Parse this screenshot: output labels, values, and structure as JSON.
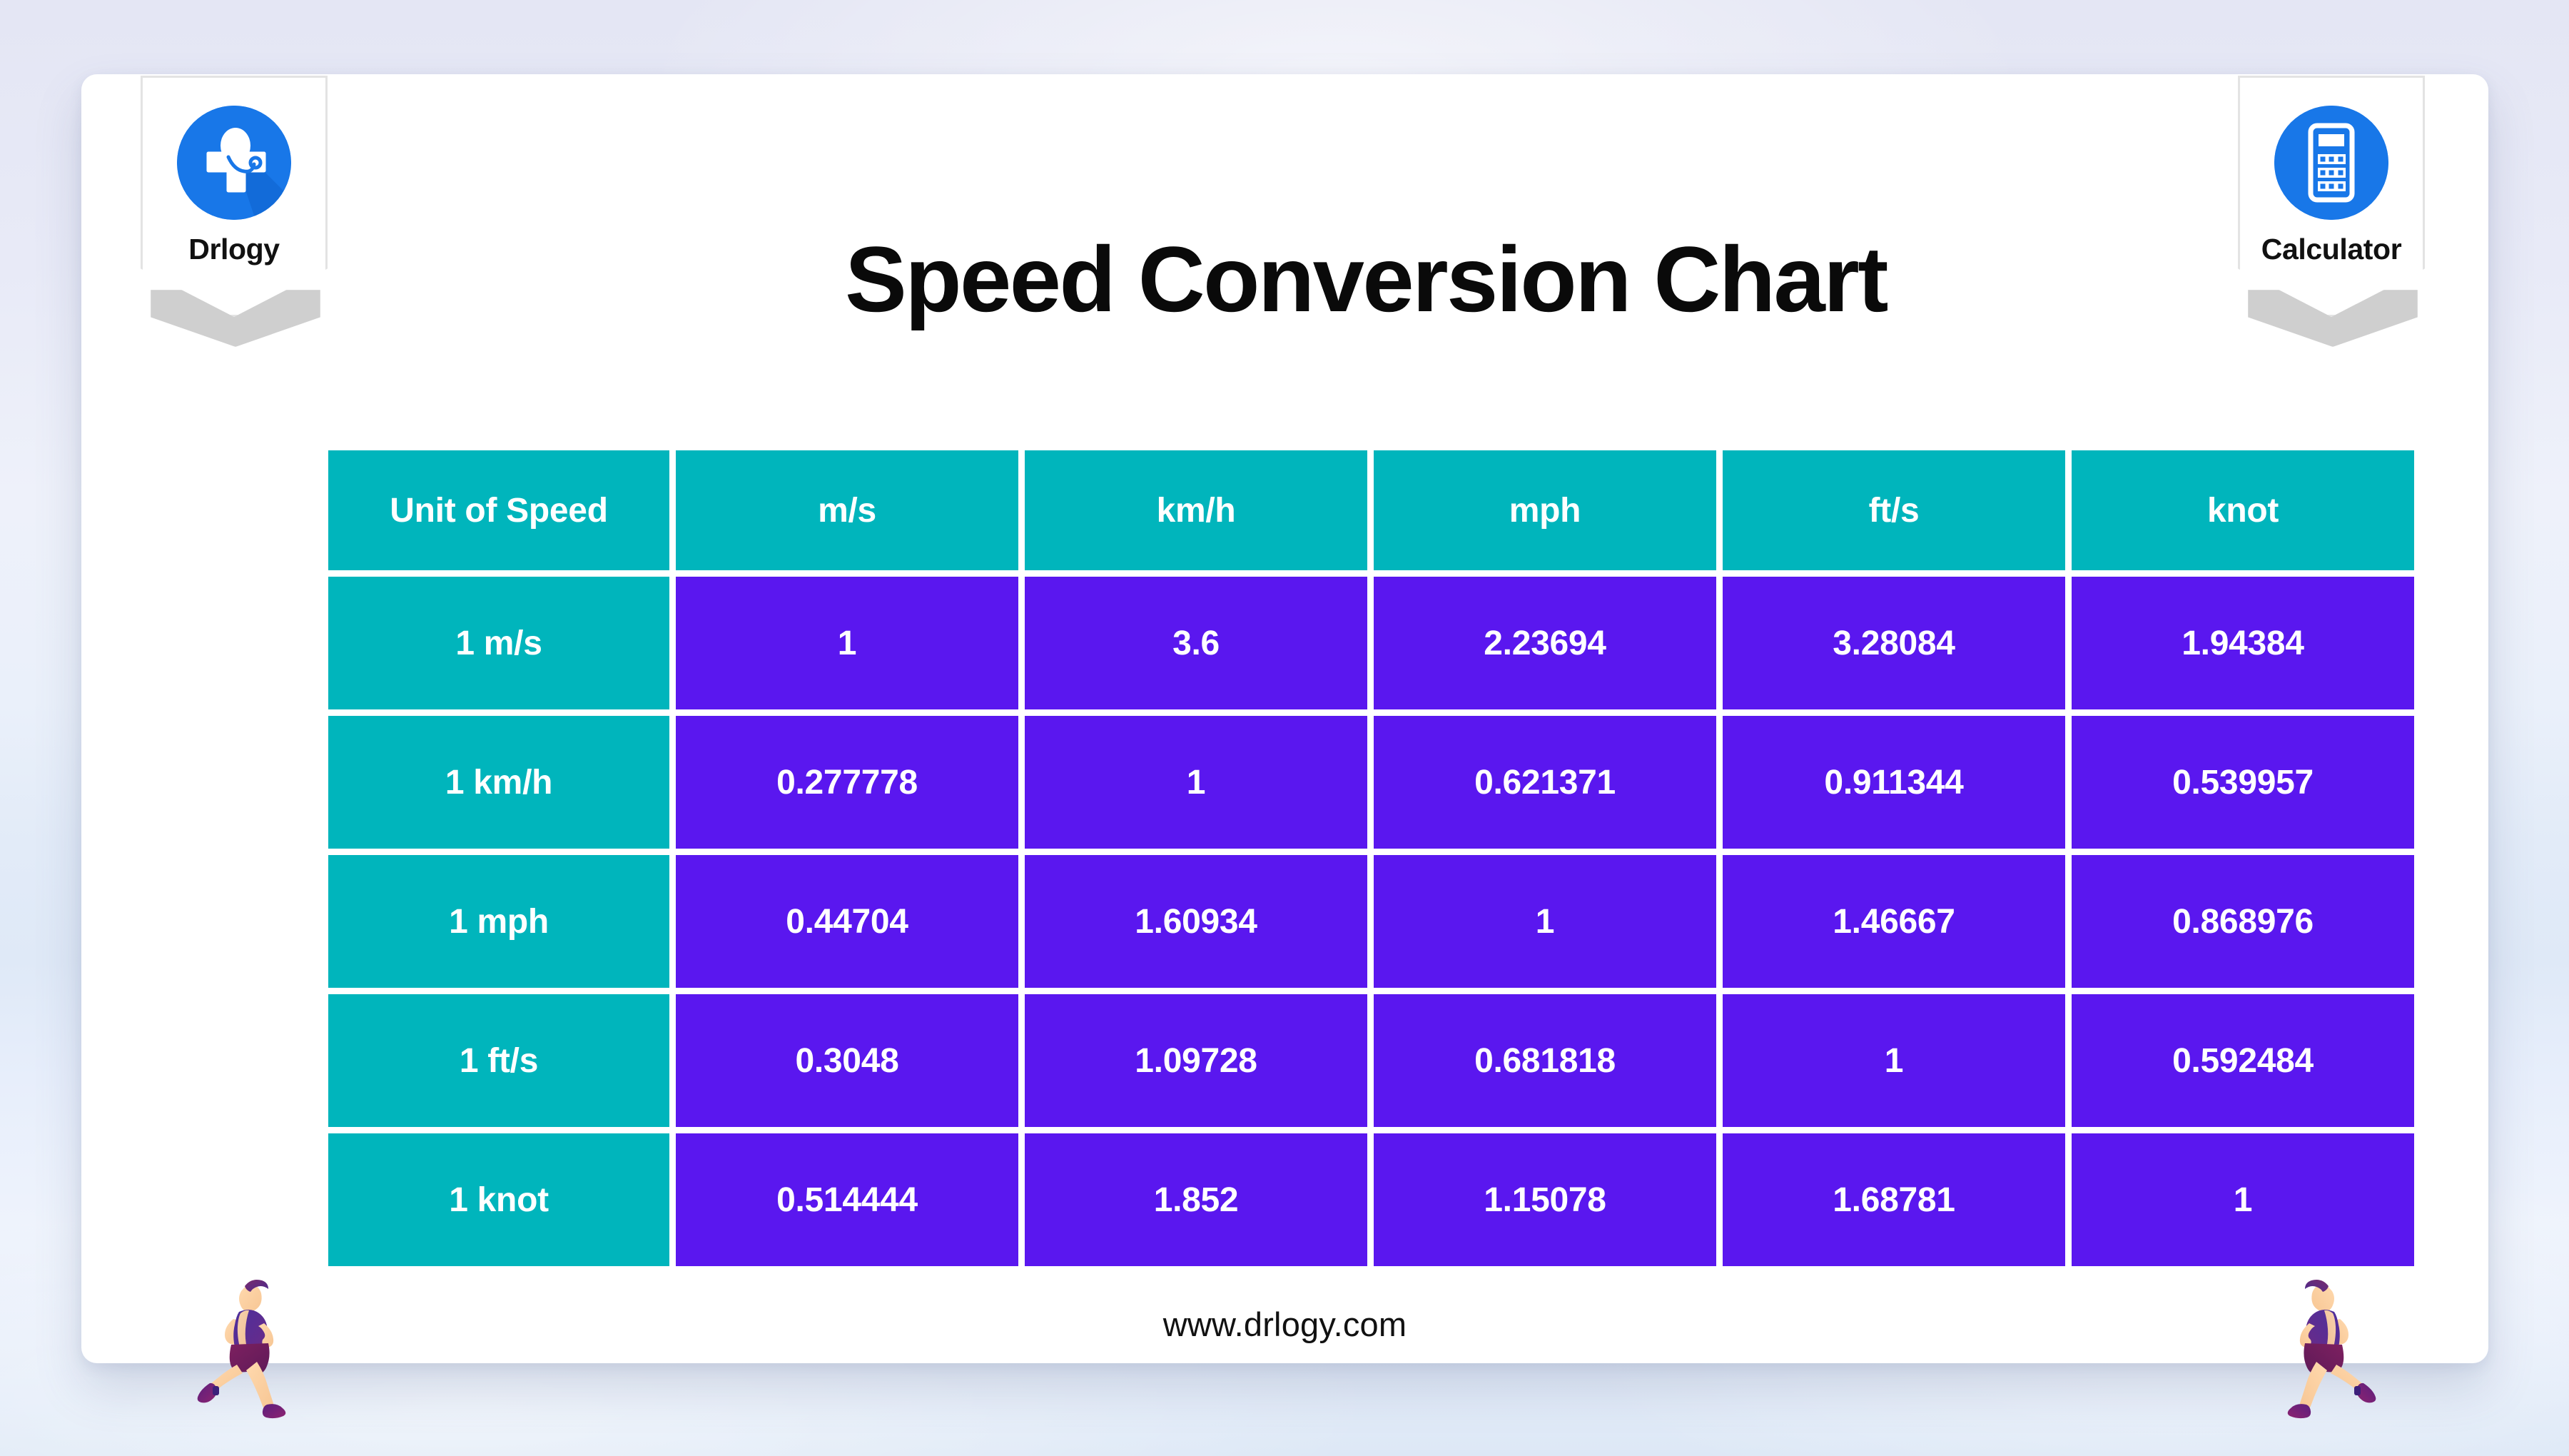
{
  "page": {
    "title": "Speed Conversion Chart",
    "footer_url": "www.drlogy.com",
    "card_background": "#ffffff",
    "background_color": "#e4e6f4"
  },
  "badges": {
    "left": {
      "label": "Drlogy",
      "icon": "medical-cross-stethoscope-icon",
      "accent": "#1877e8"
    },
    "right": {
      "label": "Calculator",
      "icon": "calculator-icon",
      "accent": "#1877e8"
    }
  },
  "decorations": {
    "runner_left": "running-man-icon",
    "runner_right": "running-man-icon"
  },
  "theme": {
    "header_teal": "#00b5bc",
    "unit_teal": "#00b5bc",
    "value_purple": "#5a17ef",
    "cell_text": "#ffffff",
    "title_text": "#0a0a0a"
  },
  "chart_data": {
    "type": "table",
    "title": "Speed Conversion Chart",
    "xlabel": "",
    "ylabel": "",
    "columns": [
      "Unit of Speed",
      "m/s",
      "km/h",
      "mph",
      "ft/s",
      "knot"
    ],
    "rows": [
      {
        "unit": "1 m/s",
        "values": [
          "1",
          "3.6",
          "2.23694",
          "3.28084",
          "1.94384"
        ]
      },
      {
        "unit": "1 km/h",
        "values": [
          "0.277778",
          "1",
          "0.621371",
          "0.911344",
          "0.539957"
        ]
      },
      {
        "unit": "1 mph",
        "values": [
          "0.44704",
          "1.60934",
          "1",
          "1.46667",
          "0.868976"
        ]
      },
      {
        "unit": "1 ft/s",
        "values": [
          "0.3048",
          "1.09728",
          "0.681818",
          "1",
          "0.592484"
        ]
      },
      {
        "unit": "1 knot",
        "values": [
          "0.514444",
          "1.852",
          "1.15078",
          "1.68781",
          "1"
        ]
      }
    ]
  }
}
